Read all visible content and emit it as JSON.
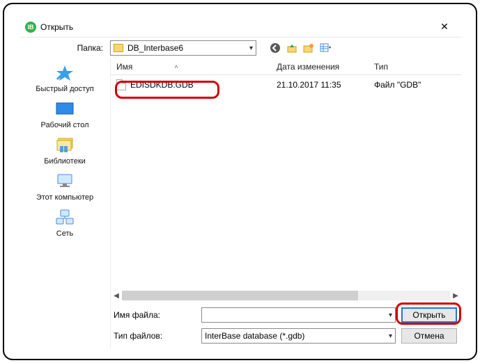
{
  "window": {
    "title": "Открыть"
  },
  "folder_row": {
    "label": "Папка:",
    "current": "DB_Interbase6"
  },
  "places": {
    "quick": {
      "label": "Быстрый доступ"
    },
    "desktop": {
      "label": "Рабочий стол"
    },
    "libs": {
      "label": "Библиотеки"
    },
    "pc": {
      "label": "Этот компьютер"
    },
    "net": {
      "label": "Сеть"
    }
  },
  "columns": {
    "name": "Имя",
    "date": "Дата изменения",
    "type": "Тип"
  },
  "files": [
    {
      "name": "EDISDKDB.GDB",
      "date": "21.10.2017 11:35",
      "type": "Файл \"GDB\""
    }
  ],
  "bottom": {
    "filename_label": "Имя файла:",
    "filename_value": "",
    "filetype_label": "Тип файлов:",
    "filetype_value": "InterBase database (*.gdb)",
    "open_label": "Открыть",
    "cancel_label": "Отмена"
  }
}
